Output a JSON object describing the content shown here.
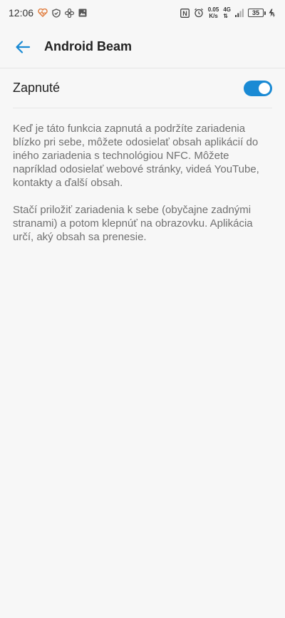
{
  "status_bar": {
    "time": "12:06",
    "left_icons": [
      "heart-monitor-icon",
      "shield-icon",
      "fan-icon",
      "image-icon"
    ],
    "nfc_label": "N",
    "net_speed_value": "0.05",
    "net_speed_unit": "K/s",
    "net_type": "4G",
    "net_type_sub": "4G",
    "battery_level": "35"
  },
  "header": {
    "title": "Android Beam"
  },
  "toggle": {
    "label": "Zapnuté",
    "state": "on",
    "accent_color": "#1a8ad4"
  },
  "description": {
    "paragraph_1": "Keď je táto funkcia zapnutá a podržíte zariadenia blízko pri sebe, môžete odosielať obsah aplikácií do iného zariadenia s technológiou NFC. Môžete napríklad odosielať webové stránky, videá YouTube, kontakty a ďalší obsah.",
    "paragraph_2": "Stačí priložiť zariadenia k sebe (obyčajne zadnými stranami) a potom klepnúť na obrazovku. Aplikácia určí, aký obsah sa prenesie."
  }
}
